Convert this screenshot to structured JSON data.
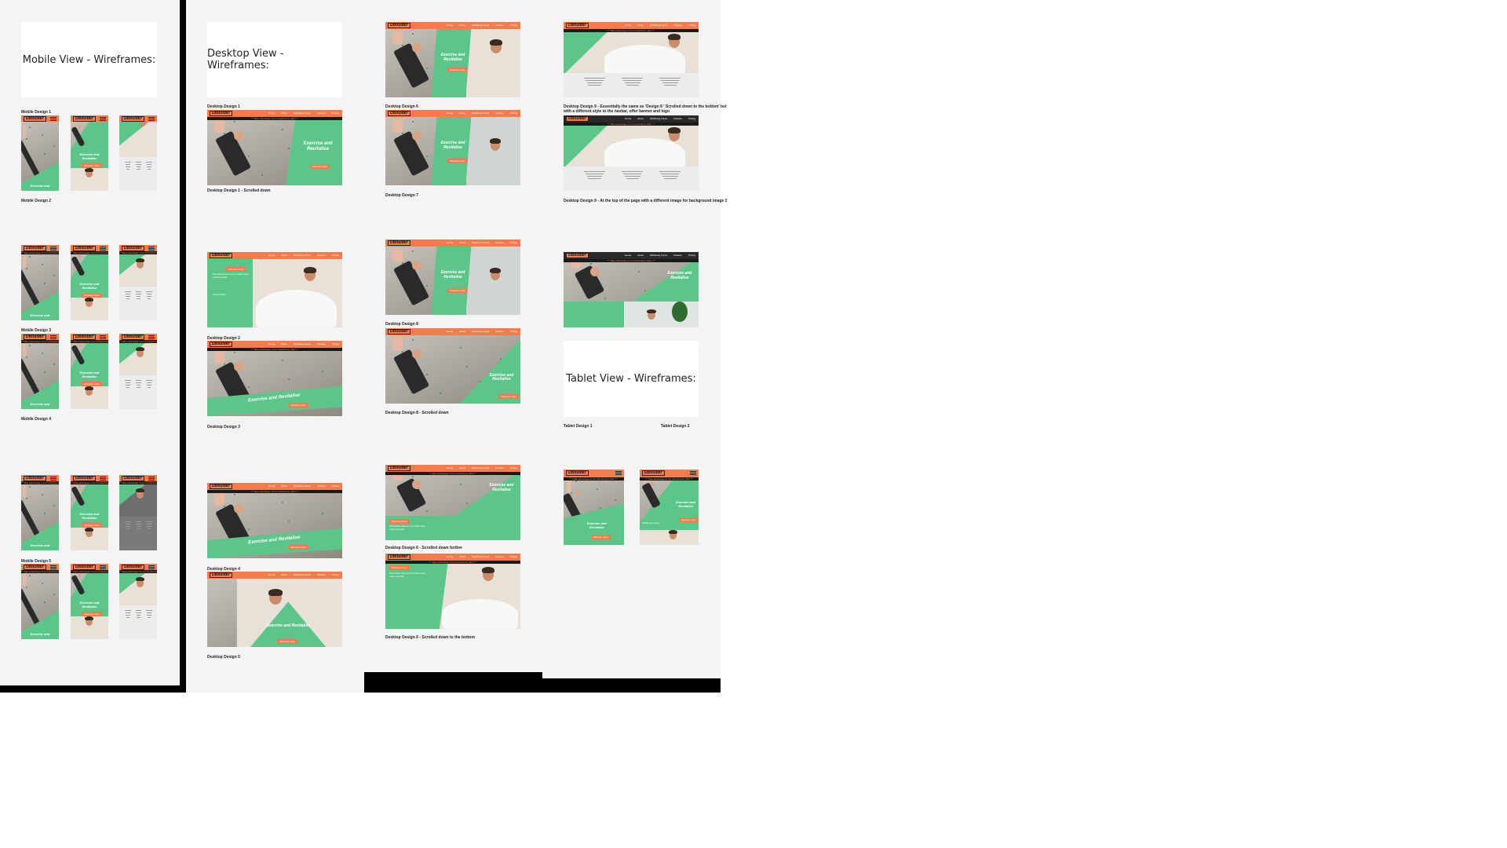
{
  "colors": {
    "accent": "#f47c4c",
    "green": "#5cc68a",
    "panel": "#f4f4f4",
    "black": "#000000"
  },
  "titles": {
    "mobile": "Mobile View - Wireframes:",
    "desktop": "Desktop View - Wireframes:",
    "tablet": "Tablet View - Wireframes:"
  },
  "captions": {
    "m1": "Mobile Design 1",
    "m2": "Mobile Design 2",
    "m3": "Mobile Design 3",
    "m4": "Mobile Design 4",
    "m5": "Mobile Design 5",
    "d1": "Desktop Design 1",
    "d1s": "Desktop Design 1 - Scrolled down",
    "d2": "Desktop Design 2",
    "d3": "Desktop Design 3",
    "d4": "Desktop Design 4",
    "d5": "Desktop Design 5",
    "d6": "Desktop Design 6",
    "d7": "Desktop Design 7",
    "d8": "Desktop Design 8",
    "d8s": "Desktop Design 8 - Scrolled down",
    "d6f": "Desktop Design 6 - Scrolled down further",
    "d6b": "Desktop Design 6 - Scrolled down to the bottom",
    "d9a": "Desktop Design 9 - Essentially the same as 'Design 8 ' Scrolled down to the bottom' but",
    "d9b": "with a different style to the navbar, offer banner and logo",
    "d9c": "Desktop Design 9 - At the top of the page with a different image for background image 2",
    "t1": "Tablet Design 1",
    "t2": "Tablet Design 2"
  },
  "site": {
    "logo": "DBoulder",
    "nav": [
      "Home",
      "About",
      "Wellbeing Focus",
      "Classes",
      "Pricing"
    ],
    "hero_multiline": "Exercise and Revitalise",
    "hero_line": "Exercise and Revitalise",
    "hero_short": "Exercise and",
    "cta": "Discover more",
    "offer": "** Take advantage of our introductory offer! **",
    "wellbeing_title": "Wellbeing Scope",
    "wellbeing_text": "We believe that our ice baths have many benefits",
    "testimonials": "Testimonials:"
  }
}
